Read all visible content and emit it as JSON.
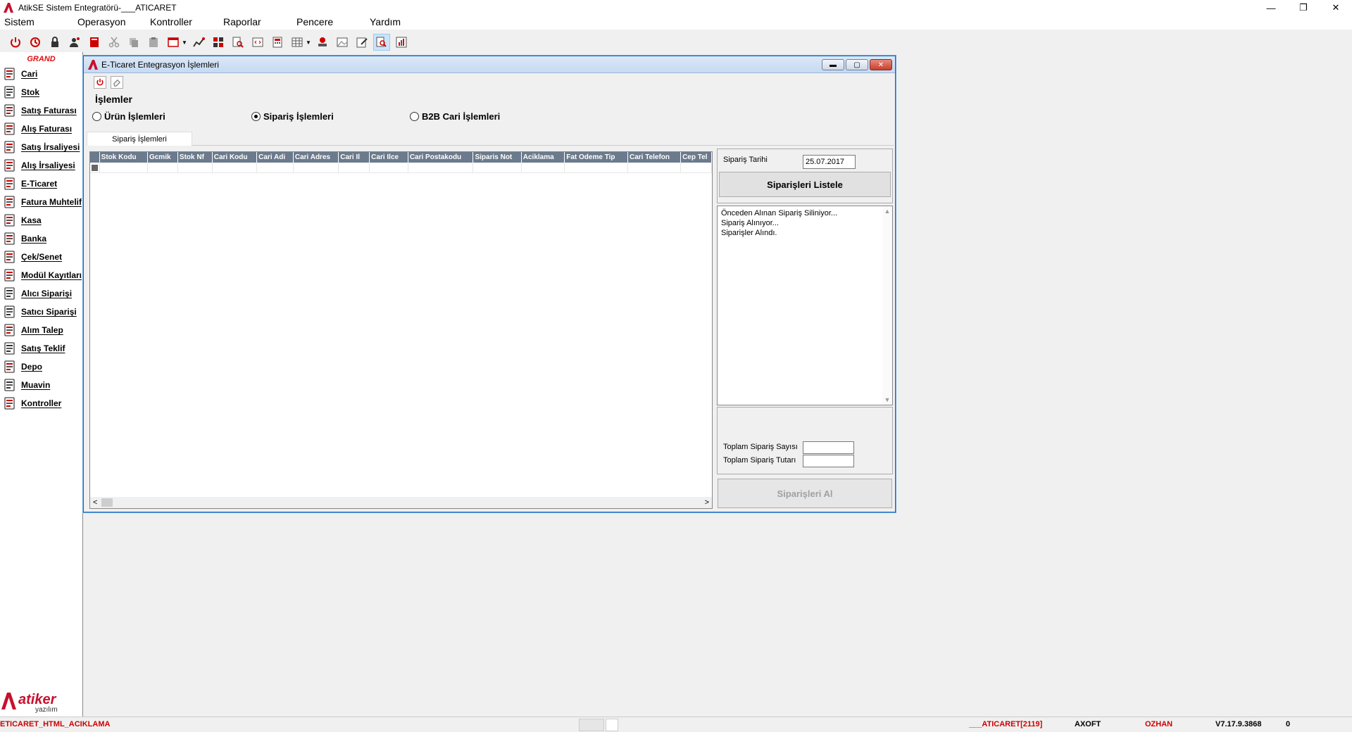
{
  "window": {
    "title": "AtikSE Sistem Entegratörü-___ATICARET",
    "minimize_glyph": "—",
    "restore_glyph": "❐",
    "close_glyph": "✕"
  },
  "menu": [
    "Sistem",
    "Operasyon",
    "Kontroller",
    "Raporlar",
    "Pencere",
    "Yardım"
  ],
  "sidebar": {
    "brand": "GRAND",
    "items": [
      {
        "label": "Cari",
        "icon": "cari-icon"
      },
      {
        "label": "Stok",
        "icon": "stok-icon"
      },
      {
        "label": "Satış Faturası",
        "icon": "satis-faturasi-icon"
      },
      {
        "label": "Alış Faturası",
        "icon": "alis-faturasi-icon"
      },
      {
        "label": "Satış İrsaliyesi",
        "icon": "satis-irsaliyesi-icon"
      },
      {
        "label": "Alış İrsaliyesi",
        "icon": "alis-irsaliyesi-icon"
      },
      {
        "label": "E-Ticaret",
        "icon": "e-ticaret-icon"
      },
      {
        "label": "Fatura Muhtelif",
        "icon": "fatura-muhtelif-icon"
      },
      {
        "label": "Kasa",
        "icon": "kasa-icon"
      },
      {
        "label": "Banka",
        "icon": "banka-icon"
      },
      {
        "label": "Çek/Senet",
        "icon": "cek-senet-icon"
      },
      {
        "label": "Modül Kayıtları",
        "icon": "modul-kayitlari-icon"
      },
      {
        "label": "Alıcı Siparişi",
        "icon": "alici-siparisi-icon"
      },
      {
        "label": "Satıcı Siparişi",
        "icon": "satici-siparisi-icon"
      },
      {
        "label": "Alım Talep",
        "icon": "alim-talep-icon"
      },
      {
        "label": "Satış Teklif",
        "icon": "satis-teklif-icon"
      },
      {
        "label": "Depo",
        "icon": "depo-icon"
      },
      {
        "label": "Muavin",
        "icon": "muavin-icon"
      },
      {
        "label": "Kontroller",
        "icon": "kontroller-icon"
      }
    ],
    "logo_text": "atiker",
    "logo_sub": "yazılım"
  },
  "child": {
    "title": "E-Ticaret Entegrasyon İşlemleri",
    "min_glyph": "▬",
    "max_glyph": "▢",
    "close_glyph": "✕",
    "section": "İşlemler",
    "radios": [
      {
        "label": "Ürün İşlemleri",
        "checked": false
      },
      {
        "label": "Sipariş İşlemleri",
        "checked": true
      },
      {
        "label": "B2B Cari İşlemleri",
        "checked": false
      }
    ],
    "tab": "Sipariş İşlemleri",
    "columns": [
      "Stok Kodu",
      "Gcmik",
      "Stok Nf",
      "Cari Kodu",
      "Cari Adi",
      "Cari Adres",
      "Cari Il",
      "Cari Ilce",
      "Cari Postakodu",
      "Siparis Not",
      "Aciklama",
      "Fat Odeme Tip",
      "Cari Telefon",
      "Cep Tel"
    ],
    "scroll_left": "<",
    "scroll_right": ">",
    "right": {
      "date_label": "Sipariş Tarihi",
      "date_value": "25.07.2017",
      "list_button": "Siparişleri Listele",
      "log_lines": [
        "Önceden Alınan Sipariş Siliniyor...",
        "Sipariş Alınıyor...",
        "Siparişler Alındı."
      ],
      "total_count_label": "Toplam Sipariş Sayısı",
      "total_count_value": "",
      "total_amount_label": "Toplam Sipariş Tutarı",
      "total_amount_value": "",
      "get_button": "Siparişleri Al"
    }
  },
  "status": {
    "left": "ETICARET_HTML_ACIKLAMA",
    "company": "___ATICARET[2119]",
    "db": "AXOFT",
    "user": "OZHAN",
    "version": "V7.17.9.3868",
    "count": "0"
  }
}
